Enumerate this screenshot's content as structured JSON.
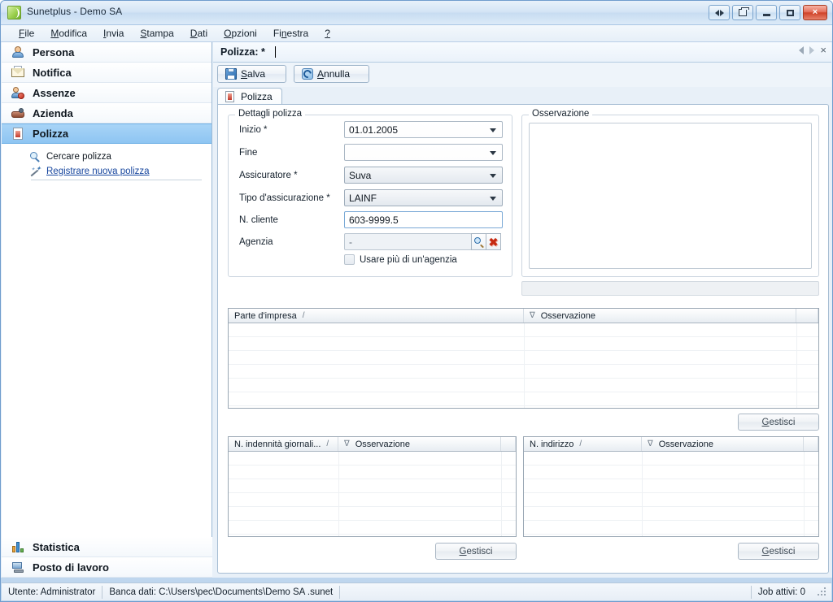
{
  "window": {
    "title": "Sunetplus - Demo SA",
    "app_icon": "sunet-leaf-icon",
    "buttons": {
      "switch": "switch-windows-button",
      "restore_parent": "restore-button",
      "minimize": "minimize-button",
      "maximize": "maximize-button",
      "close": "×"
    }
  },
  "menu": [
    {
      "label": "File",
      "accel": "F"
    },
    {
      "label": "Modifica",
      "accel": "M"
    },
    {
      "label": "Invia",
      "accel": "I"
    },
    {
      "label": "Stampa",
      "accel": "S"
    },
    {
      "label": "Dati",
      "accel": "D"
    },
    {
      "label": "Opzioni",
      "accel": "O"
    },
    {
      "label": "Finestra",
      "accel": "n"
    },
    {
      "label": "?",
      "accel": ""
    }
  ],
  "sidebar": {
    "items": [
      {
        "label": "Persona",
        "icon": "person-icon",
        "active": false
      },
      {
        "label": "Notifica",
        "icon": "mail-icon",
        "active": false
      },
      {
        "label": "Assenze",
        "icon": "person-absence-icon",
        "active": false
      },
      {
        "label": "Azienda",
        "icon": "company-icon",
        "active": false
      },
      {
        "label": "Polizza",
        "icon": "document-icon",
        "active": true
      }
    ],
    "sub_items": [
      {
        "label": "Cercare polizza",
        "icon": "magnifier-icon",
        "link": false
      },
      {
        "label": "Registrare nuova polizza",
        "icon": "wand-icon",
        "link": true
      }
    ],
    "bottom_items": [
      {
        "label": "Statistica",
        "icon": "statistics-icon"
      },
      {
        "label": "Posto di lavoro",
        "icon": "workstation-icon"
      }
    ]
  },
  "document": {
    "tab_title": "Polizza: *",
    "nav": {
      "prev": "prev-record-icon",
      "next": "next-record-icon",
      "close": "×"
    }
  },
  "toolbar": {
    "save_label": "Salva",
    "save_accel": "S",
    "cancel_label": "Annulla",
    "cancel_accel": "A"
  },
  "tabs": [
    {
      "label": "Polizza",
      "icon": "policy-document-icon",
      "active": true
    }
  ],
  "form": {
    "group_title": "Dettagli polizza",
    "fields": [
      {
        "label": "Inizio",
        "required": true,
        "value": "01.01.2005",
        "type": "date-combo",
        "style": "white"
      },
      {
        "label": "Fine",
        "required": false,
        "value": "",
        "type": "date-combo",
        "style": "white"
      },
      {
        "label": "Assicuratore",
        "required": true,
        "value": "Suva",
        "type": "combo",
        "style": "grey"
      },
      {
        "label": "Tipo d'assicurazione",
        "required": true,
        "value": "LAINF",
        "type": "combo",
        "style": "grey"
      },
      {
        "label": "N. cliente",
        "required": false,
        "value": "603-9999.5",
        "type": "text",
        "style": "blue"
      },
      {
        "label": "Agenzia",
        "required": false,
        "value": "-",
        "type": "lookup",
        "style": "readonly"
      }
    ],
    "checkbox": {
      "label": "Usare più di un'agenzia",
      "checked": false
    },
    "lookup_buttons": {
      "search": "search-icon",
      "clear": "clear-icon"
    }
  },
  "observation": {
    "group_title": "Osservazione",
    "text": "",
    "placeholder": ""
  },
  "grids": [
    {
      "name": "parte-impresa-grid",
      "columns": [
        "Parte d'impresa",
        "Osservazione"
      ],
      "sort_mark": "/",
      "filter_mark": "∇",
      "rows": [],
      "empty_row_count": 6,
      "action_button": {
        "label": "Gestisci",
        "accel": "G"
      }
    },
    {
      "name": "indennita-giornaliera-grid",
      "columns": [
        "N. indennità giornali...",
        "Osservazione"
      ],
      "sort_mark": "/",
      "filter_mark": "∇",
      "rows": [],
      "empty_row_count": 6,
      "action_button": {
        "label": "Gestisci",
        "accel": "G"
      }
    },
    {
      "name": "indirizzo-grid",
      "columns": [
        "N. indirizzo",
        "Osservazione"
      ],
      "sort_mark": "/",
      "filter_mark": "∇",
      "rows": [],
      "empty_row_count": 6,
      "action_button": {
        "label": "Gestisci",
        "accel": "G"
      }
    }
  ],
  "statusbar": {
    "user": "Utente: Administrator",
    "database": "Banca dati: C:\\Users\\pec\\Documents\\Demo SA .sunet",
    "jobs": "Job attivi: 0"
  },
  "colors": {
    "accent_blue": "#8ec5f2",
    "link_blue": "#17469e",
    "close_red": "#cf4228",
    "titlebar": "#d3e4f5"
  }
}
